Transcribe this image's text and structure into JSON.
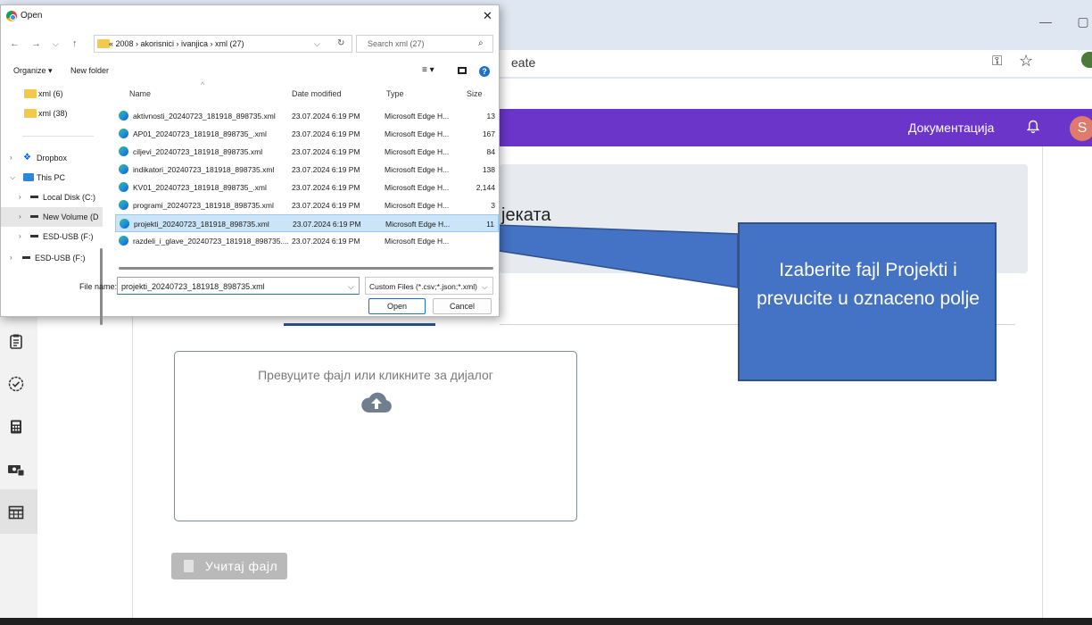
{
  "browser": {
    "address_text": "eate",
    "window_controls": [
      "minimize-icon",
      "maximize-icon"
    ],
    "address_icons": [
      "key-icon",
      "star-icon"
    ]
  },
  "app": {
    "nav_link": "Документација",
    "avatar_initial": "S",
    "accent_color": "#6b35c9",
    "sidebar_icons": [
      "clipboard-icon",
      "check-circle-icon",
      "calculator-icon",
      "money-icon",
      "table-icon"
    ],
    "page_title_partial": "јеката",
    "dropzone_text": "Превуците фајл или кликните за дијалог",
    "load_button": "Учитај фајл"
  },
  "callout": {
    "text": "Izaberite fajl Projekti i prevucite u oznaceno polje",
    "color": "#4472c4"
  },
  "dialog": {
    "title": "Open",
    "path": "« 2008 › akorisnici › ivanjica › xml (27)",
    "search_placeholder": "Search xml (27)",
    "toolbar": {
      "organize": "Organize ▾",
      "new_folder": "New folder"
    },
    "nav_items": [
      {
        "label": "xml (6)",
        "icon": "folder-icon"
      },
      {
        "label": "xml (38)",
        "icon": "folder-icon"
      },
      {
        "label": "Dropbox",
        "icon": "dropbox-icon"
      },
      {
        "label": "This PC",
        "icon": "pc-icon"
      },
      {
        "label": "Local Disk (C:)",
        "icon": "drive-icon"
      },
      {
        "label": "New Volume (D",
        "icon": "drive-icon"
      },
      {
        "label": "ESD-USB (F:)",
        "icon": "drive-icon"
      },
      {
        "label": "ESD-USB (F:)",
        "icon": "drive-icon"
      }
    ],
    "columns": [
      "Name",
      "Date modified",
      "Type",
      "Size"
    ],
    "files": [
      {
        "name": "aktivnosti_20240723_181918_898735.xml",
        "date": "23.07.2024 6:19 PM",
        "type": "Microsoft Edge H...",
        "size": "13"
      },
      {
        "name": "AP01_20240723_181918_898735_.xml",
        "date": "23.07.2024 6:19 PM",
        "type": "Microsoft Edge H...",
        "size": "167"
      },
      {
        "name": "ciljevi_20240723_181918_898735.xml",
        "date": "23.07.2024 6:19 PM",
        "type": "Microsoft Edge H...",
        "size": "84"
      },
      {
        "name": "indikatori_20240723_181918_898735.xml",
        "date": "23.07.2024 6:19 PM",
        "type": "Microsoft Edge H...",
        "size": "138"
      },
      {
        "name": "KV01_20240723_181918_898735_.xml",
        "date": "23.07.2024 6:19 PM",
        "type": "Microsoft Edge H...",
        "size": "2,144"
      },
      {
        "name": "programi_20240723_181918_898735.xml",
        "date": "23.07.2024 6:19 PM",
        "type": "Microsoft Edge H...",
        "size": "3"
      },
      {
        "name": "projekti_20240723_181918_898735.xml",
        "date": "23.07.2024 6:19 PM",
        "type": "Microsoft Edge H...",
        "size": "11"
      },
      {
        "name": "razdeli_i_glave_20240723_181918_898735....",
        "date": "23.07.2024 6:19 PM",
        "type": "Microsoft Edge H...",
        "size": ""
      }
    ],
    "selected_index": 6,
    "file_name_label": "File name:",
    "file_name_value": "projekti_20240723_181918_898735.xml",
    "file_type_value": "Custom Files (*.csv;*.json;*.xml)",
    "open_label": "Open",
    "cancel_label": "Cancel"
  }
}
